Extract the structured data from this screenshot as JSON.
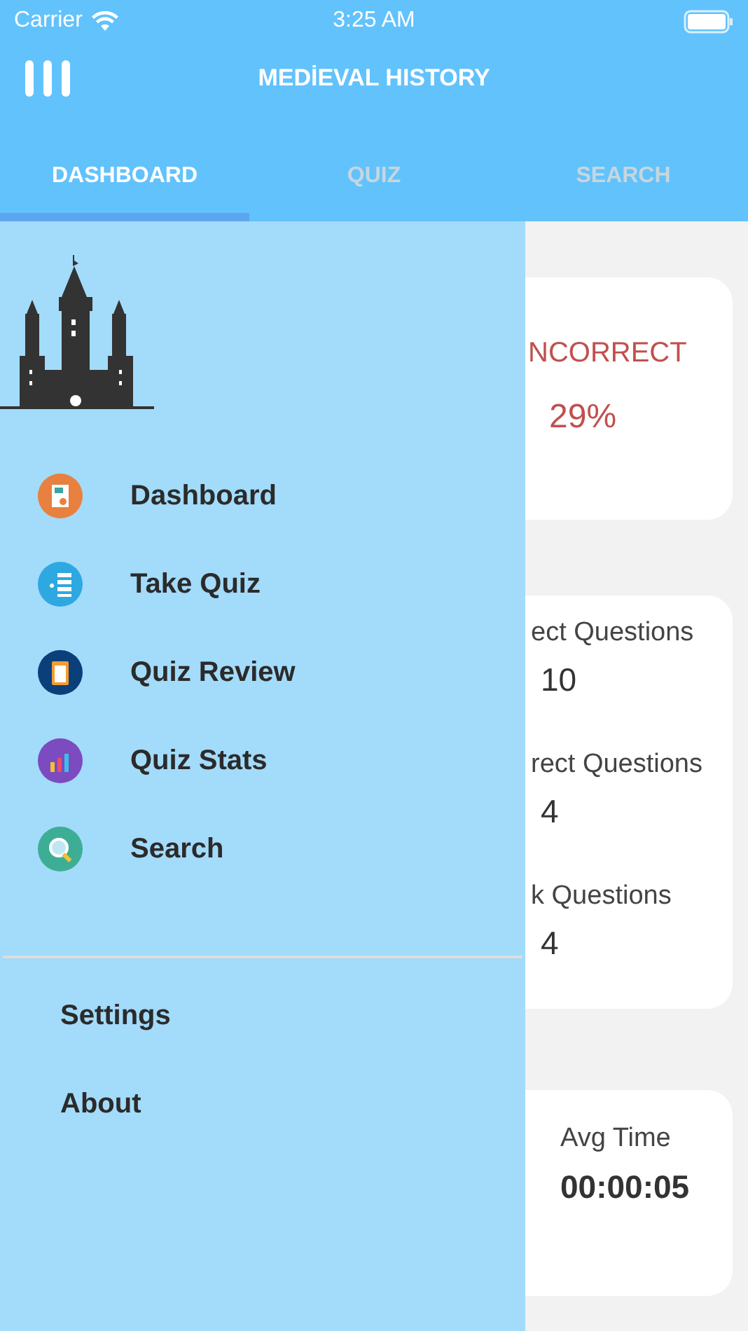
{
  "status_bar": {
    "carrier": "Carrier",
    "time": "3:25 AM"
  },
  "header": {
    "title": "MEDİEVAL HISTORY"
  },
  "tabs": [
    {
      "label": "DASHBOARD",
      "selected": true
    },
    {
      "label": "QUIZ",
      "selected": false
    },
    {
      "label": "SEARCH",
      "selected": false
    }
  ],
  "dashboard": {
    "performance": {
      "incorrect_label": "NCORRECT",
      "incorrect_value": "29%"
    },
    "questions": [
      {
        "label": "ect Questions",
        "value": "10"
      },
      {
        "label": "rect Questions",
        "value": "4"
      },
      {
        "label": "k Questions",
        "value": "4"
      }
    ],
    "time": [
      {
        "label": "Avg Time",
        "value": "00:00:05"
      }
    ]
  },
  "drawer": {
    "menu": [
      {
        "kind": "dashboard",
        "label": "Dashboard",
        "color": "#e8803f"
      },
      {
        "kind": "quiz",
        "label": "Take Quiz",
        "color": "#2ea8e0"
      },
      {
        "kind": "review",
        "label": "Quiz Review",
        "color": "#0a3f7a"
      },
      {
        "kind": "stats",
        "label": "Quiz Stats",
        "color": "#7c4bbf"
      },
      {
        "kind": "search",
        "label": "Search",
        "color": "#3dae95"
      }
    ],
    "links": [
      "Settings",
      "About"
    ]
  }
}
